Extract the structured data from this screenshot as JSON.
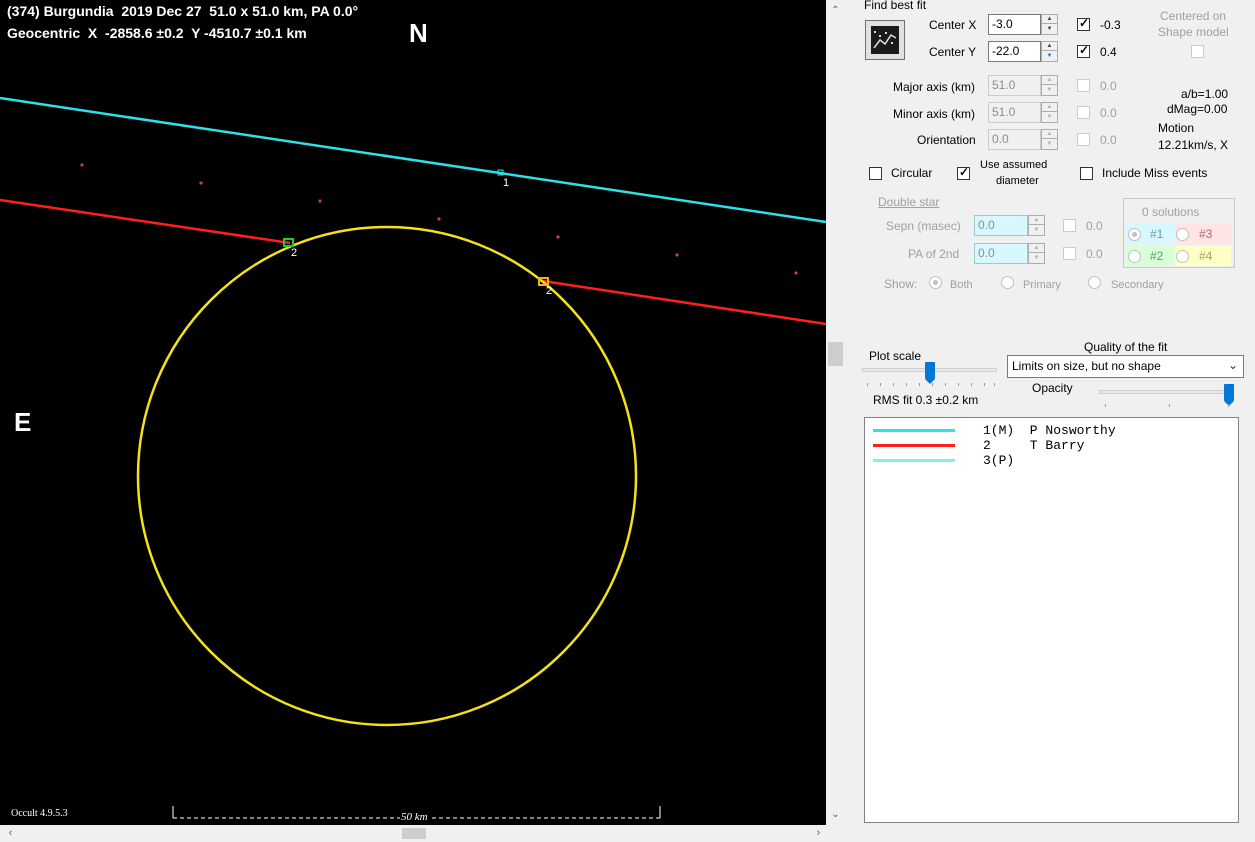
{
  "plot": {
    "title_line1": "(374) Burgundia  2019 Dec 27  51.0 x 51.0 km, PA 0.0°",
    "title_line2": "Geocentric  X  -2858.6 ±0.2  Y -4510.7 ±0.1 km",
    "north_label": "N",
    "east_label": "E",
    "version": "Occult 4.9.5.3",
    "scale_label": "50 km",
    "chord_label_1": "1",
    "chord_label_2a": "2",
    "chord_label_2b": "2",
    "colors": {
      "chord1": "#2ee0e8",
      "chord2": "#ff1f1f",
      "ellipse": "#f2e21a",
      "dots": "#c04060"
    }
  },
  "panel": {
    "find_best_fit_label": "Find best fit",
    "center_x_label": "Center X",
    "center_x_value": "-3.0",
    "center_x_check_label": "-0.3",
    "center_y_label": "Center Y",
    "center_y_value": "-22.0",
    "center_y_check_label": "0.4",
    "centered_on_label": "Centered on",
    "shape_model_label": "Shape model",
    "major_axis_label": "Major axis (km)",
    "major_axis_value": "51.0",
    "major_axis_check_label": "0.0",
    "minor_axis_label": "Minor axis (km)",
    "minor_axis_value": "51.0",
    "minor_axis_check_label": "0.0",
    "orientation_label": "Orientation",
    "orientation_value": "0.0",
    "orientation_check_label": "0.0",
    "ab_label": "a/b=1.00",
    "dmag_label": "dMag=0.00",
    "motion_label": "Motion",
    "motion_value": "12.21km/s, X",
    "circular_label": "Circular",
    "use_assumed_label_1": "Use assumed",
    "use_assumed_label_2": "diameter",
    "include_miss_label": "Include Miss events",
    "double_star_label": "Double star",
    "sepn_label": "Sepn (masec)",
    "sepn_value": "0.0",
    "sepn_check_label": "0.0",
    "pa2nd_label": "PA of 2nd",
    "pa2nd_value": "0.0",
    "pa2nd_check_label": "0.0",
    "solutions_label": "0 solutions",
    "sol1": "#1",
    "sol2": "#2",
    "sol3": "#3",
    "sol4": "#4",
    "show_label": "Show:",
    "show_both": "Both",
    "show_primary": "Primary",
    "show_secondary": "Secondary",
    "plot_scale_label": "Plot scale",
    "quality_label": "Quality of the fit",
    "quality_value": "Limits on size, but no shape",
    "opacity_label": "Opacity",
    "rms_label": "RMS fit 0.3 ±0.2 km",
    "plot_scale_level": 0.5,
    "opacity_level": 1.0
  },
  "legend": [
    {
      "text": "1(M)  P Nosworthy",
      "color": "#2ee0e8"
    },
    {
      "text": "2     T Barry",
      "color": "#ff1f1f"
    },
    {
      "text": "3(P)",
      "color": "#7ff5d8"
    }
  ]
}
